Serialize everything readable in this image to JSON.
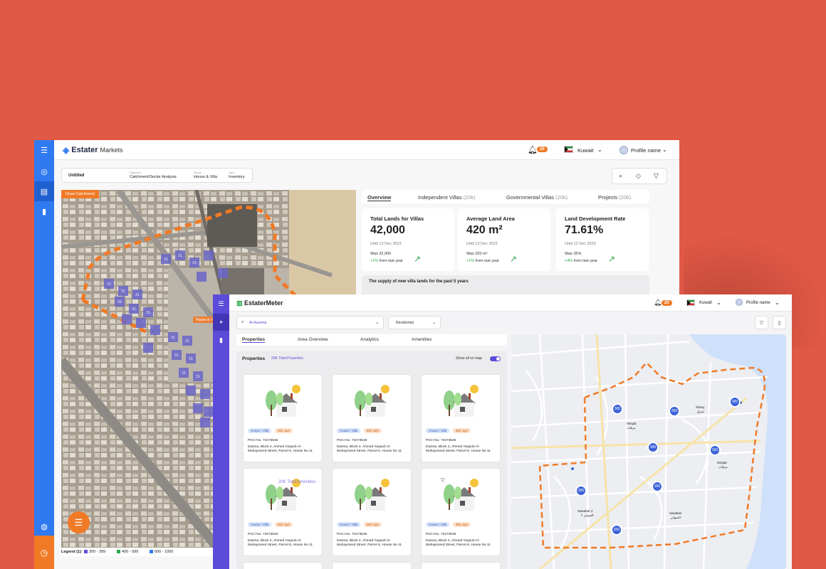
{
  "markets": {
    "logo_brand": "Estater",
    "logo_product": "Markets",
    "notifications_count": "20",
    "country": "Kuwait",
    "profile": "Profile name",
    "breadcrumb": {
      "name": "Untitled",
      "items": [
        {
          "key": "Objective",
          "value": "Catchment/Sector Analysis"
        },
        {
          "key": "Sector",
          "value": "House & Villa"
        },
        {
          "key": "Type",
          "value": "Inventory"
        }
      ]
    },
    "draw_catchment": "Draw Catchment",
    "legend": {
      "label": "Legend (1):",
      "items": [
        {
          "label": "300 - 399",
          "color": "#5B4BD8"
        },
        {
          "label": "400 - 599",
          "color": "#2aa84a"
        },
        {
          "label": "600 - 1000",
          "color": "#2F7AF0"
        }
      ]
    },
    "tabs": [
      {
        "label": "Overview",
        "count": ""
      },
      {
        "label": "Independent Villas",
        "count": "(20k)"
      },
      {
        "label": "Governmental Villas",
        "count": "(20k)"
      },
      {
        "label": "Projects",
        "count": "(20k)"
      }
    ],
    "cards": [
      {
        "title": "Total Lands for Villas",
        "value": "42,000",
        "date": "Until 12 Dec 2023",
        "was": "Was 32,000",
        "change": "+1%",
        "change_suffix": "from last year"
      },
      {
        "title": "Average Land Area",
        "value": "420 m²",
        "date": "Until 12 Dec 2023",
        "was": "Was 320 m²",
        "change": "+1%",
        "change_suffix": "from last year"
      },
      {
        "title": "Land Development Rate",
        "value": "71.61%",
        "date": "Until 12 Dec 2023",
        "was": "Was 35%",
        "change": "+4%",
        "change_suffix": "from last year"
      }
    ],
    "supply_title": "The supply of new villa lands for the past 5 years",
    "map_label": "House & V",
    "cluster_values": [
      "31",
      "31",
      "31",
      "31",
      "31",
      "31",
      "31",
      "31",
      "31",
      "31",
      "31",
      "31",
      "31",
      "31",
      "31",
      "31",
      "31",
      "31",
      "31",
      "31",
      "31",
      "31",
      "31",
      "31",
      "31",
      "31",
      "31",
      "31"
    ]
  },
  "meter": {
    "logo_brand": "EstaterMeter",
    "notifications_count": "20",
    "country": "Kuwait",
    "profile": "Profile name",
    "area_select": "Al-Aseema",
    "type_select": "Residential",
    "tabs": [
      "Properties",
      "Area Overview",
      "Analytics",
      "Amenities"
    ],
    "properties_title": "Properties",
    "properties_count": "20K Total Properties",
    "show_all_on_map": "Show all on map",
    "amenities_overlay": "20K Total Amenities",
    "property_cards": [
      {
        "type": "House / Villa",
        "area": "802 sqm",
        "paci": "PACI No. 73473546",
        "address": "Dasma, Block 2, Ahmed Yaqoub Al-Muhaymeed Street, Parcel 6, House No 11"
      },
      {
        "type": "House / Villa",
        "area": "802 sqm",
        "paci": "PACI No. 73473546",
        "address": "Dasma, Block 2, Ahmed Yaqoub Al-Muhaymeed Street, Parcel 6, House No 11"
      },
      {
        "type": "House / Villa",
        "area": "802 sqm",
        "paci": "PACI No. 73473546",
        "address": "Dasma, Block 2, Ahmed Yaqoub Al-Muhaymeed Street, Parcel 6, House No 11"
      },
      {
        "type": "House / Villa",
        "area": "802 sqm",
        "paci": "PACI No. 73473546",
        "address": "Dasma, Block 2, Ahmed Yaqoub Al-Muhaymeed Street, Parcel 6, House No 11"
      },
      {
        "type": "House / Villa",
        "area": "802 sqm",
        "paci": "PACI No. 73473546",
        "address": "Dasma, Block 2, Ahmed Yaqoub Al-Muhaymeed Street, Parcel 6, House No 11"
      },
      {
        "type": "House / Villa",
        "area": "802 sqm",
        "paci": "PACI No. 73473546",
        "address": "Dasma, Block 2, Ahmed Yaqoub Al-Muhaymeed Street, Parcel 6, House No 11"
      }
    ],
    "map_clusters": [
      "300",
      "300",
      "300",
      "300",
      "300",
      "300",
      "300",
      "300",
      "300"
    ],
    "map_places": [
      {
        "en": "Sharq",
        "ar": "شرق"
      },
      {
        "en": "Mirqab",
        "ar": "مرقاب"
      },
      {
        "en": "Mirqab",
        "ar": "مرقاب"
      },
      {
        "en": "Sawaber 2",
        "ar": "الصوابر ٢"
      },
      {
        "en": "Sawaber",
        "ar": "الصوابر"
      }
    ]
  }
}
